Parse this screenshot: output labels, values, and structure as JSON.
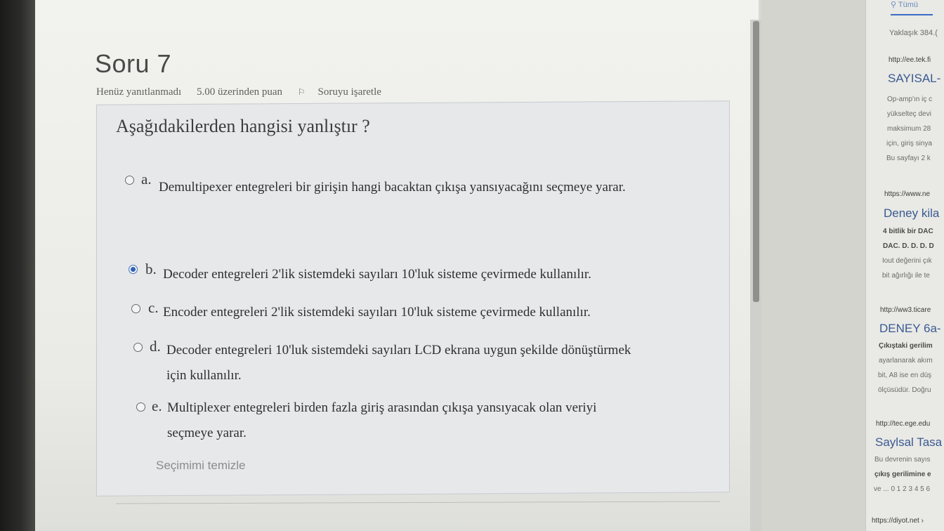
{
  "question": {
    "title": "Soru 7",
    "status": "Henüz yanıtlanmadı",
    "points": "5.00 üzerinden puan",
    "flag_label": "Soruyu işaretle",
    "prompt": "Aşağıdakilerden hangisi yanlıştır ?",
    "options": [
      {
        "letter": "a.",
        "text": "Demultipexer entegreleri bir girişin hangi bacaktan çıkışa yansıyacağını seçmeye yarar.",
        "selected": false
      },
      {
        "letter": "b.",
        "text": "Decoder entegreleri 2'lik sistemdeki sayıları 10'luk sisteme çevirmede kullanılır.",
        "selected": true
      },
      {
        "letter": "c.",
        "text": "Encoder entegreleri 2'lik sistemdeki sayıları 10'luk sisteme çevirmede kullanılır.",
        "selected": false
      },
      {
        "letter": "d.",
        "text_line1": "Decoder entegreleri 10'luk sistemdeki sayıları LCD ekrana uygun şekilde dönüştürmek",
        "text_line2": "için kullanılır.",
        "selected": false
      },
      {
        "letter": "e.",
        "text_line1": "Multiplexer entegreleri birden fazla giriş arasından çıkışa yansıyacak olan veriyi",
        "text_line2": "seçmeye yarar.",
        "selected": false
      }
    ],
    "clear_label": "Seçimimi temizle"
  },
  "search_panel": {
    "tab_label": "Tümü",
    "count": "Yaklaşık 384.(",
    "results": [
      {
        "url": "http://ee.tek.fi",
        "title": "SAYISAL-",
        "lines": [
          "Op-amp'ın iç c",
          "yükselteç devi",
          "maksimum 28",
          "için, giriş sinya",
          "Bu sayfayı 2 k"
        ]
      },
      {
        "url": "https://www.ne",
        "title": "Deney kila",
        "lines": [
          "4 bitlik bir DAC",
          "DAC. D. D. D. D",
          "Iout değerini çık",
          "bit ağırlığı ile te"
        ]
      },
      {
        "url": "http://ww3.ticare",
        "title": "DENEY 6a-",
        "lines": [
          "Çıkıştaki gerilim",
          "ayarlanarak akım",
          "bit, A8 ise en düş",
          "ölçüsüdür. Doğru"
        ]
      },
      {
        "url": "http://tec.ege.edu",
        "title": "Saylsal Tasa",
        "lines": [
          "Bu devrenin sayıs",
          "çıkış gerilimine e",
          "ve ... 0 1 2 3 4 5 6"
        ]
      },
      {
        "url": "https://diyot.net ›",
        "title": "",
        "lines": []
      }
    ]
  }
}
